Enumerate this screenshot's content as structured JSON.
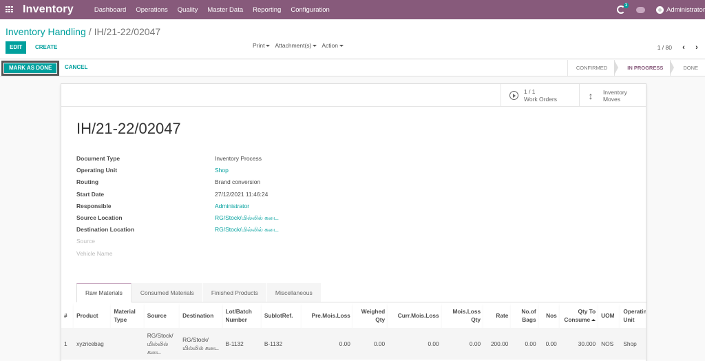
{
  "navbar": {
    "app_title": "Inventory",
    "menu": [
      "Dashboard",
      "Operations",
      "Quality",
      "Master Data",
      "Reporting",
      "Configuration"
    ],
    "activity_count": "1",
    "user": "Administrator",
    "brand_color": "#875a7b"
  },
  "breadcrumb": {
    "parent": "Inventory Handling",
    "separator": "/",
    "current": "IH/21-22/02047"
  },
  "toolbar": {
    "edit": "EDIT",
    "create": "CREATE",
    "print": "Print",
    "attachments": "Attachment(s)",
    "action": "Action",
    "pager": "1 / 80",
    "prev_icon": "chevron-left",
    "next_icon": "chevron-right",
    "accent_color": "#00a09d"
  },
  "statusbar": {
    "mark_done": "MARK AS DONE",
    "cancel": "CANCEL",
    "steps": [
      "CONFIRMED",
      "IN PROGRESS",
      "DONE"
    ],
    "active_step": "IN PROGRESS"
  },
  "smart_buttons": {
    "work_orders_count": "1 / 1",
    "work_orders_label": "Work Orders",
    "inventory_moves": "Inventory Moves"
  },
  "record": {
    "title": "IH/21-22/02047",
    "fields": [
      {
        "label": "Document Type",
        "value": "Inventory Process",
        "link": false
      },
      {
        "label": "Operating Unit",
        "value": "Shop",
        "link": true
      },
      {
        "label": "Routing",
        "value": "Brand conversion",
        "link": false
      },
      {
        "label": "Start Date",
        "value": "27/12/2021 11:46:24",
        "link": false
      },
      {
        "label": "Responsible",
        "value": "Administrator",
        "link": true
      },
      {
        "label": "Source Location",
        "value": "RG/Stock/மில்லில் கடை",
        "link": true
      },
      {
        "label": "Destination Location",
        "value": "RG/Stock/மில்லில் கடை",
        "link": true
      },
      {
        "label": "Source",
        "value": "",
        "link": false
      },
      {
        "label": "Vehicle Name",
        "value": "",
        "link": false
      }
    ]
  },
  "notebook": {
    "tabs": [
      "Raw Materials",
      "Consumed Materials",
      "Finished Products",
      "Miscellaneous"
    ],
    "active_tab": "Raw Materials"
  },
  "raw_materials": {
    "columns": [
      "#",
      "Product",
      "Material Type",
      "Source",
      "Destination",
      "Lot/Batch Number",
      "SublotRef.",
      "Pre.Mois.Loss",
      "Weighed Qty",
      "Curr.Mois.Loss",
      "Mois.Loss Qty",
      "Rate",
      "No.of Bags",
      "Nos",
      "Qty To Consume",
      "UOM",
      "Operating Unit"
    ],
    "rows": [
      [
        "1",
        "xyzricebag",
        "",
        "RG/Stock/மில்லில் கடை",
        "RG/Stock/மில்லில் கடை",
        "B-1132",
        "B-1132",
        "0.00",
        "0.00",
        "0.00",
        "0.00",
        "200.00",
        "0.00",
        "0.00",
        "30.000",
        "NOS",
        "Shop"
      ]
    ],
    "sorted_column": "Qty To Consume"
  }
}
